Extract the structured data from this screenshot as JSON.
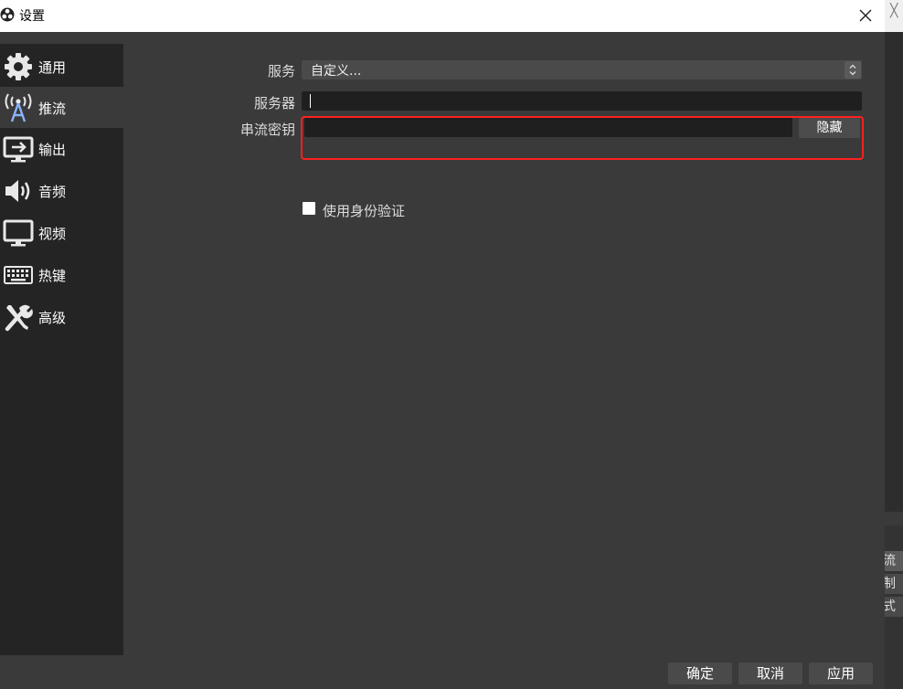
{
  "window": {
    "title": "设置"
  },
  "sidebar": {
    "items": [
      {
        "label": "通用",
        "icon": "gear-icon"
      },
      {
        "label": "推流",
        "icon": "broadcast-antenna-icon"
      },
      {
        "label": "输出",
        "icon": "output-monitor-icon"
      },
      {
        "label": "音频",
        "icon": "speaker-icon"
      },
      {
        "label": "视频",
        "icon": "monitor-icon"
      },
      {
        "label": "热键",
        "icon": "keyboard-icon"
      },
      {
        "label": "高级",
        "icon": "tools-icon"
      }
    ],
    "active_index": 1
  },
  "stream": {
    "service_label": "服务",
    "service_value": "自定义...",
    "server_label": "服务器",
    "server_value": "",
    "stream_key_label": "串流密钥",
    "stream_key_value": "",
    "hide_button": "隐藏",
    "auth_label": "使用身份验证",
    "auth_checked": false
  },
  "footer": {
    "ok": "确定",
    "cancel": "取消",
    "apply": "应用"
  },
  "background_window": {
    "buttons": [
      "流",
      "制",
      "式"
    ]
  },
  "colors": {
    "highlight_border": "#ff2020",
    "dialog_bg": "#3a3a3a",
    "sidebar_bg": "#242424"
  }
}
